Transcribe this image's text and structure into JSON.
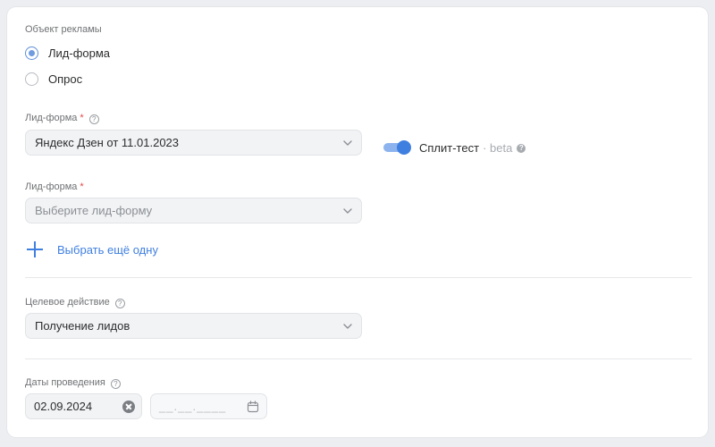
{
  "ad_object": {
    "label": "Объект рекламы",
    "options": [
      {
        "label": "Лид-форма",
        "selected": true
      },
      {
        "label": "Опрос",
        "selected": false
      }
    ]
  },
  "lead_form_1": {
    "label": "Лид-форма",
    "required_mark": "*",
    "value": "Яндекс Дзен от 11.01.2023"
  },
  "split_test": {
    "label": "Сплит-тест",
    "suffix": "· beta",
    "enabled": true
  },
  "lead_form_2": {
    "label": "Лид-форма",
    "required_mark": "*",
    "placeholder": "Выберите лид-форму"
  },
  "add_another": {
    "label": "Выбрать ещё одну"
  },
  "target_action": {
    "label": "Целевое действие",
    "value": "Получение лидов"
  },
  "dates": {
    "label": "Даты проведения",
    "start": "02.09.2024",
    "end_placeholder": "__.__.____"
  },
  "icons": {
    "help": "question-circle-icon",
    "dropdown": "chevron-down-icon",
    "add": "plus-icon",
    "clear": "clear-circle-icon",
    "calendar": "calendar-icon"
  },
  "colors": {
    "accent": "#3f7fe0",
    "required": "#e64646",
    "field_bg": "#f2f3f5"
  }
}
